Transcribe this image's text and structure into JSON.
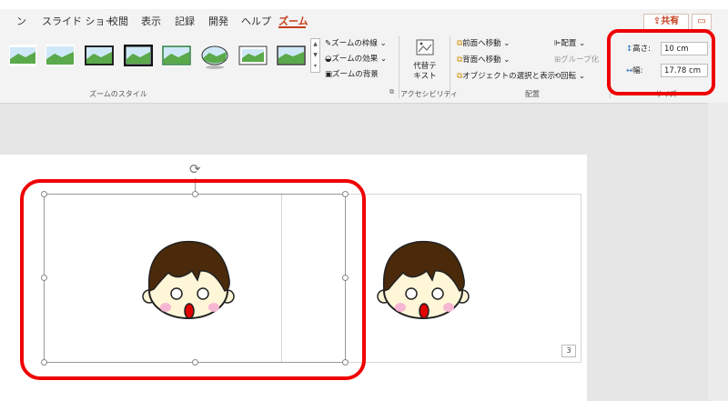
{
  "tabs": [
    "ン",
    "スライド ショー",
    "校閲",
    "表示",
    "記録",
    "開発",
    "ヘルプ",
    "ズーム"
  ],
  "active_tab": "ズーム",
  "share_label": "共有",
  "zoom_styles_group_label": "ズームのスタイル",
  "zoom_options": {
    "border": "ズームの枠線",
    "effects": "ズームの効果",
    "background": "ズームの背景"
  },
  "accessibility": {
    "alt_text_line1": "代替テ",
    "alt_text_line2": "キスト",
    "group_label": "アクセシビリティ"
  },
  "arrange": {
    "bring_forward": "前面へ移動",
    "send_backward": "背面へ移動",
    "selection_pane": "オブジェクトの選択と表示",
    "align": "配置",
    "group": "グループ化",
    "rotate": "回転",
    "group_label": "配置"
  },
  "size": {
    "height_label": "高さ:",
    "height_value": "10 cm",
    "width_label": "幅:",
    "width_value": "17.78 cm",
    "group_label": "サイズ"
  },
  "slide_number": "3",
  "colors": {
    "accent": "#c43e1c",
    "highlight": "#e00000",
    "hair": "#4a2a0b",
    "mouth": "#e00000"
  }
}
